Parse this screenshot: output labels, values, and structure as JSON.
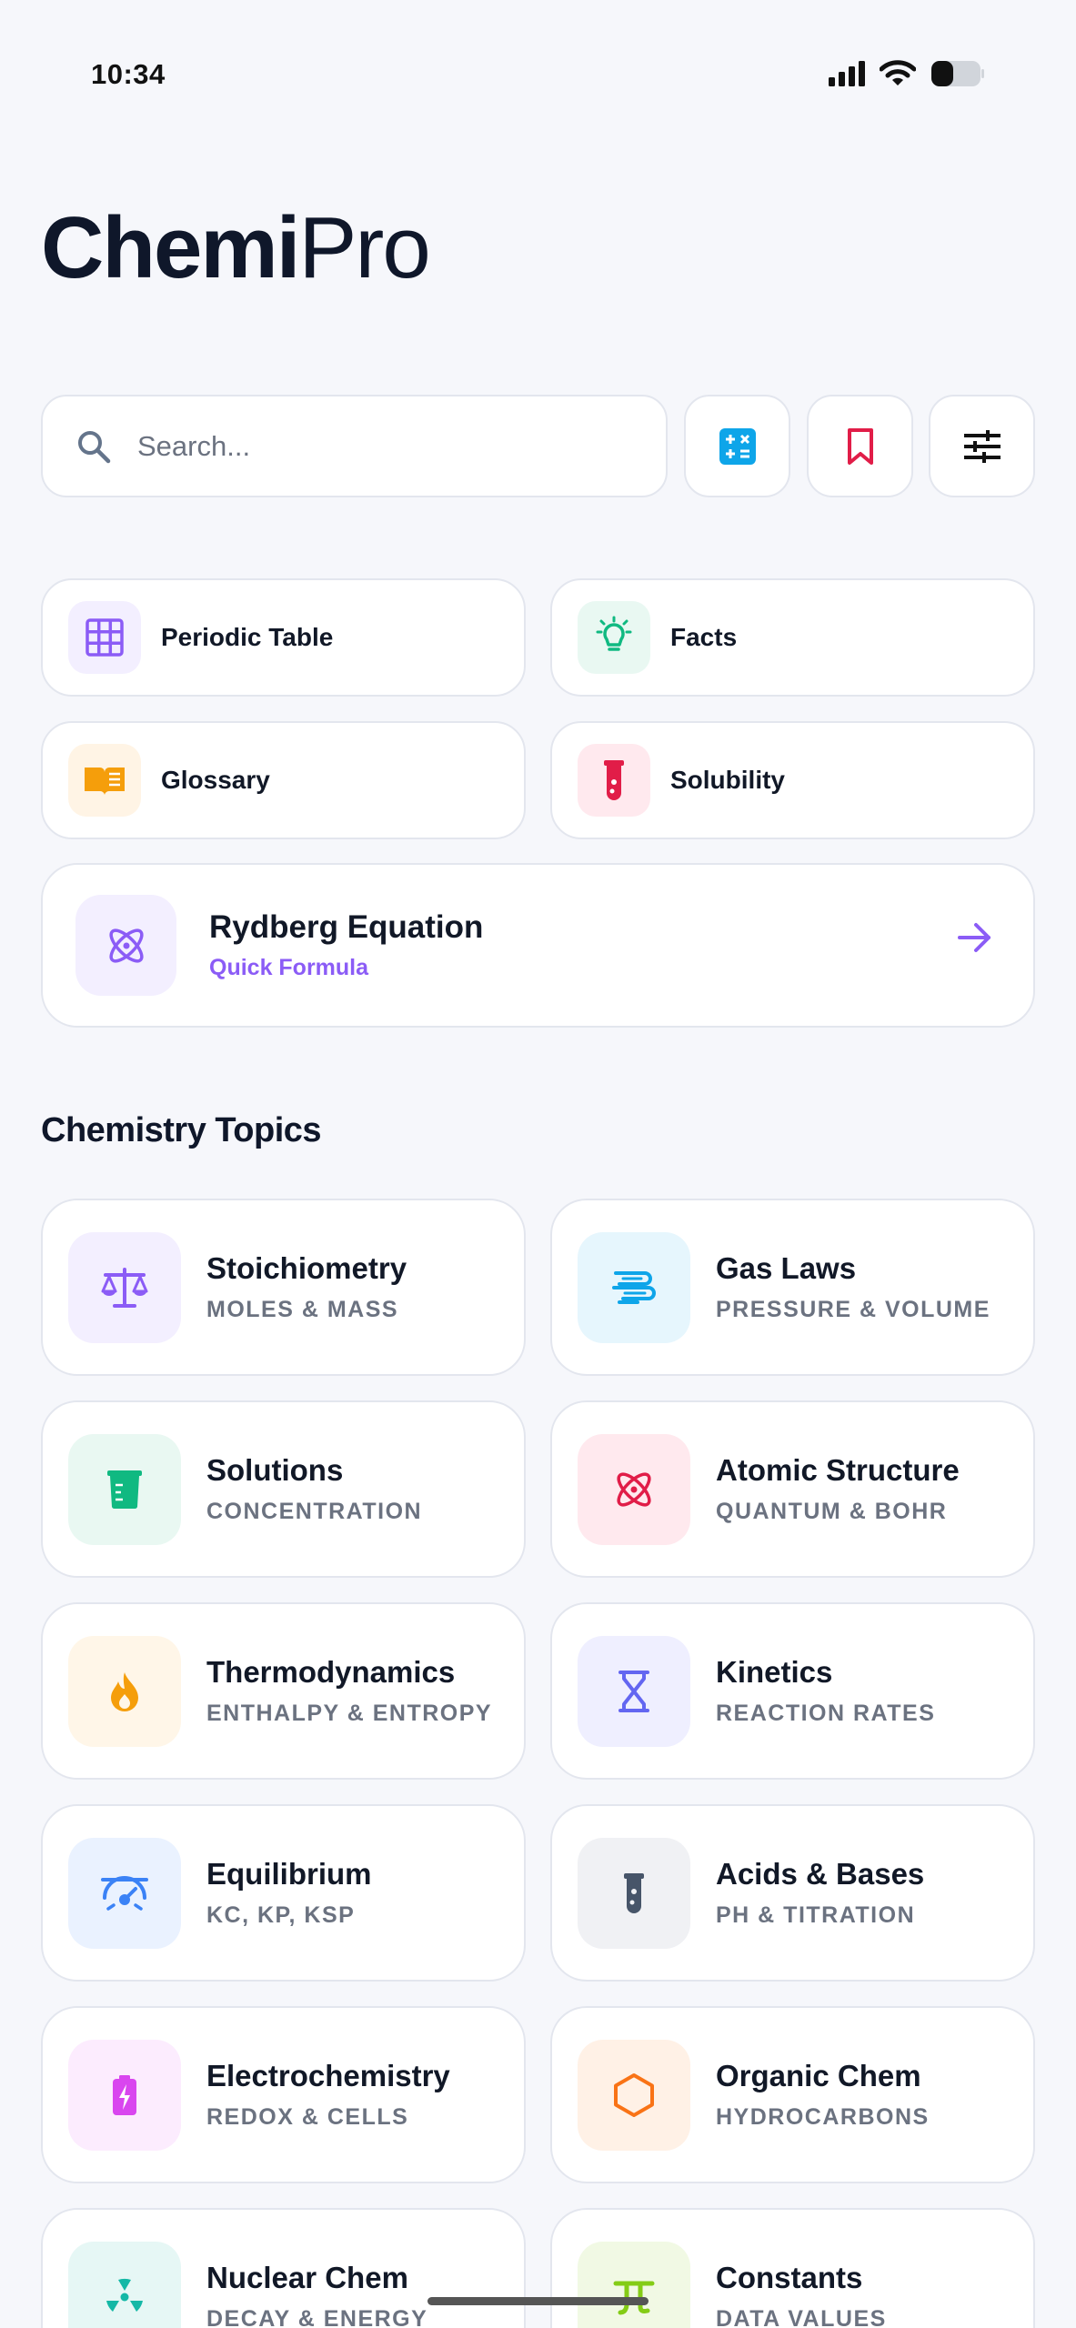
{
  "status": {
    "time": "10:34"
  },
  "app": {
    "title_bold": "Chemi",
    "title_light": "Pro"
  },
  "search": {
    "placeholder": "Search..."
  },
  "quick_links": [
    {
      "label": "Periodic Table",
      "icon": "grid-icon",
      "color": "#8b5cf6",
      "bg": "#f3efff"
    },
    {
      "label": "Facts",
      "icon": "lightbulb-icon",
      "color": "#10b981",
      "bg": "#e9f8f2"
    },
    {
      "label": "Glossary",
      "icon": "open-book-icon",
      "color": "#f59e0b",
      "bg": "#fff4e5"
    },
    {
      "label": "Solubility",
      "icon": "test-tube-icon",
      "color": "#e11d48",
      "bg": "#ffe9ee"
    }
  ],
  "formula": {
    "title": "Rydberg Equation",
    "subtitle": "Quick Formula",
    "icon": "atom-icon",
    "accent": "#8b5cf6"
  },
  "section": {
    "title": "Chemistry Topics"
  },
  "topics": [
    {
      "name": "Stoichiometry",
      "sub": "MOLES & MASS",
      "icon": "scale-icon",
      "color": "#8b5cf6",
      "bg": "#f3efff"
    },
    {
      "name": "Gas Laws",
      "sub": "PRESSURE & VOLUME",
      "icon": "wind-icon",
      "color": "#0ea5e9",
      "bg": "#e6f6fd"
    },
    {
      "name": "Solutions",
      "sub": "CONCENTRATION",
      "icon": "beaker-icon",
      "color": "#10b981",
      "bg": "#e9f8f2"
    },
    {
      "name": "Atomic Structure",
      "sub": "QUANTUM & BOHR",
      "icon": "atom-icon",
      "color": "#e11d48",
      "bg": "#ffe9ee"
    },
    {
      "name": "Thermodynamics",
      "sub": "ENTHALPY & ENTROPY",
      "icon": "flame-icon",
      "color": "#f59e0b",
      "bg": "#fff6e8"
    },
    {
      "name": "Kinetics",
      "sub": "REACTION RATES",
      "icon": "hourglass-icon",
      "color": "#6366f1",
      "bg": "#efefff"
    },
    {
      "name": "Equilibrium",
      "sub": "KC, KP, KSP",
      "icon": "gauge-icon",
      "color": "#3b82f6",
      "bg": "#eaf2ff"
    },
    {
      "name": "Acids & Bases",
      "sub": "PH & TITRATION",
      "icon": "vial-icon",
      "color": "#475569",
      "bg": "#f0f1f4"
    },
    {
      "name": "Electrochemistry",
      "sub": "REDOX & CELLS",
      "icon": "battery-icon",
      "color": "#d946ef",
      "bg": "#fcecfe"
    },
    {
      "name": "Organic Chem",
      "sub": "HYDROCARBONS",
      "icon": "hexagon-icon",
      "color": "#f97316",
      "bg": "#fff1e6"
    },
    {
      "name": "Nuclear Chem",
      "sub": "DECAY & ENERGY",
      "icon": "radiation-icon",
      "color": "#14b8a6",
      "bg": "#e6f7f5"
    },
    {
      "name": "Constants",
      "sub": "DATA VALUES",
      "icon": "pi-icon",
      "color": "#84cc16",
      "bg": "#f1f9e4"
    }
  ]
}
